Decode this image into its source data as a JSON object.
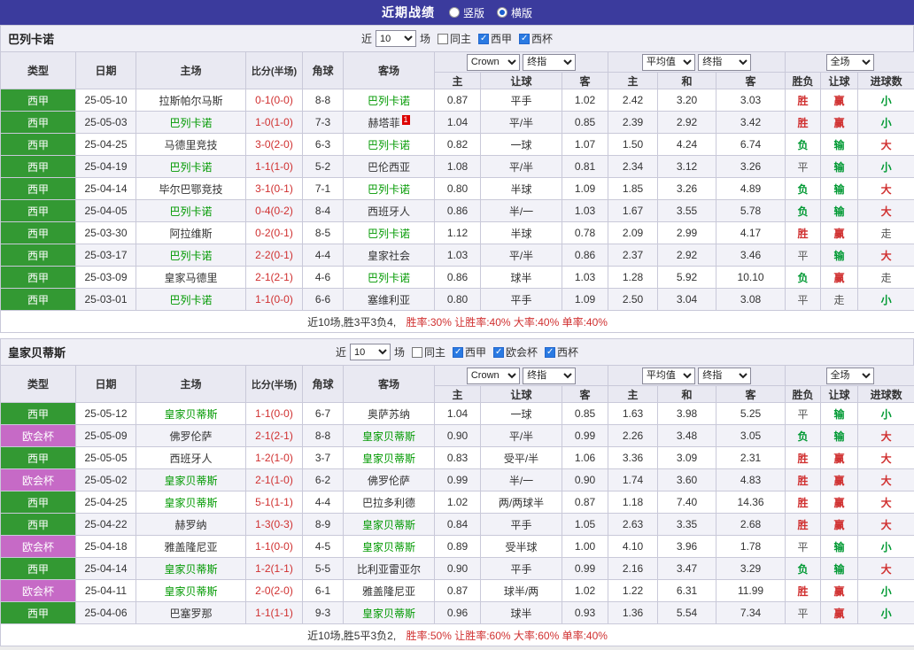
{
  "colors": {
    "topbar_bg": "#3b3b9d",
    "header_bg": "#e9e9f2",
    "liga_green": "#339933",
    "uecl_purple": "#c66ac6",
    "focus_team_green": "#009900",
    "win_red": "#d03030",
    "lose_green": "#009933",
    "draw_gray": "#555555"
  },
  "top_bar": {
    "title": "近期战绩",
    "radios": [
      {
        "label": "竖版",
        "selected": false
      },
      {
        "label": "横版",
        "selected": true
      }
    ]
  },
  "sections": [
    {
      "team": "巴列卡诺",
      "filter": {
        "prefix": "近",
        "count": "10",
        "suffix": "场",
        "checkboxes": [
          {
            "label": "同主",
            "checked": false
          },
          {
            "label": "西甲",
            "checked": true
          },
          {
            "label": "西杯",
            "checked": true
          }
        ]
      },
      "header": {
        "type": "类型",
        "date": "日期",
        "home": "主场",
        "score": "比分(半场)",
        "corner": "角球",
        "away": "客场",
        "odds_select1": "Crown",
        "odds_select2": "终指",
        "odds_home": "主",
        "odds_line": "让球",
        "odds_away": "客",
        "avg_select1": "平均值",
        "avg_select2": "终指",
        "avg_home": "主",
        "avg_draw": "和",
        "avg_away": "客",
        "result_select": "全场",
        "result_wdl": "胜负",
        "result_handicap": "让球",
        "result_goals": "进球数"
      },
      "rows": [
        {
          "league": "西甲",
          "lcls": "liga",
          "date": "25-05-10",
          "home": "拉斯帕尔马斯",
          "hf": false,
          "score": "0-1(0-0)",
          "corner": "8-8",
          "away": "巴列卡诺",
          "af": true,
          "odds": [
            "0.87",
            "平手",
            "1.02"
          ],
          "avg": [
            "2.42",
            "3.20",
            "3.03"
          ],
          "res": [
            [
              "胜",
              "r"
            ],
            [
              "赢",
              "r"
            ],
            [
              "小",
              "g"
            ]
          ]
        },
        {
          "league": "西甲",
          "lcls": "liga",
          "date": "25-05-03",
          "home": "巴列卡诺",
          "hf": true,
          "score": "1-0(1-0)",
          "corner": "7-3",
          "away": "赫塔菲",
          "af": false,
          "acard": "1",
          "odds": [
            "1.04",
            "平/半",
            "0.85"
          ],
          "avg": [
            "2.39",
            "2.92",
            "3.42"
          ],
          "res": [
            [
              "胜",
              "r"
            ],
            [
              "赢",
              "r"
            ],
            [
              "小",
              "g"
            ]
          ]
        },
        {
          "league": "西甲",
          "lcls": "liga",
          "date": "25-04-25",
          "home": "马德里竞技",
          "hf": false,
          "score": "3-0(2-0)",
          "corner": "6-3",
          "away": "巴列卡诺",
          "af": true,
          "odds": [
            "0.82",
            "一球",
            "1.07"
          ],
          "avg": [
            "1.50",
            "4.24",
            "6.74"
          ],
          "res": [
            [
              "负",
              "g"
            ],
            [
              "输",
              "g"
            ],
            [
              "大",
              "r"
            ]
          ]
        },
        {
          "league": "西甲",
          "lcls": "liga",
          "date": "25-04-19",
          "home": "巴列卡诺",
          "hf": true,
          "score": "1-1(1-0)",
          "corner": "5-2",
          "away": "巴伦西亚",
          "af": false,
          "odds": [
            "1.08",
            "平/半",
            "0.81"
          ],
          "avg": [
            "2.34",
            "3.12",
            "3.26"
          ],
          "res": [
            [
              "平",
              "d"
            ],
            [
              "输",
              "g"
            ],
            [
              "小",
              "g"
            ]
          ]
        },
        {
          "league": "西甲",
          "lcls": "liga",
          "date": "25-04-14",
          "home": "毕尔巴鄂竞技",
          "hf": false,
          "score": "3-1(0-1)",
          "corner": "7-1",
          "away": "巴列卡诺",
          "af": true,
          "odds": [
            "0.80",
            "半球",
            "1.09"
          ],
          "avg": [
            "1.85",
            "3.26",
            "4.89"
          ],
          "res": [
            [
              "负",
              "g"
            ],
            [
              "输",
              "g"
            ],
            [
              "大",
              "r"
            ]
          ]
        },
        {
          "league": "西甲",
          "lcls": "liga",
          "date": "25-04-05",
          "home": "巴列卡诺",
          "hf": true,
          "score": "0-4(0-2)",
          "corner": "8-4",
          "away": "西班牙人",
          "af": false,
          "odds": [
            "0.86",
            "半/一",
            "1.03"
          ],
          "avg": [
            "1.67",
            "3.55",
            "5.78"
          ],
          "res": [
            [
              "负",
              "g"
            ],
            [
              "输",
              "g"
            ],
            [
              "大",
              "r"
            ]
          ]
        },
        {
          "league": "西甲",
          "lcls": "liga",
          "date": "25-03-30",
          "home": "阿拉维斯",
          "hf": false,
          "score": "0-2(0-1)",
          "corner": "8-5",
          "away": "巴列卡诺",
          "af": true,
          "odds": [
            "1.12",
            "半球",
            "0.78"
          ],
          "avg": [
            "2.09",
            "2.99",
            "4.17"
          ],
          "res": [
            [
              "胜",
              "r"
            ],
            [
              "赢",
              "r"
            ],
            [
              "走",
              "d"
            ]
          ]
        },
        {
          "league": "西甲",
          "lcls": "liga",
          "date": "25-03-17",
          "home": "巴列卡诺",
          "hf": true,
          "score": "2-2(0-1)",
          "corner": "4-4",
          "away": "皇家社会",
          "af": false,
          "odds": [
            "1.03",
            "平/半",
            "0.86"
          ],
          "avg": [
            "2.37",
            "2.92",
            "3.46"
          ],
          "res": [
            [
              "平",
              "d"
            ],
            [
              "输",
              "g"
            ],
            [
              "大",
              "r"
            ]
          ]
        },
        {
          "league": "西甲",
          "lcls": "liga",
          "date": "25-03-09",
          "home": "皇家马德里",
          "hf": false,
          "score": "2-1(2-1)",
          "corner": "4-6",
          "away": "巴列卡诺",
          "af": true,
          "odds": [
            "0.86",
            "球半",
            "1.03"
          ],
          "avg": [
            "1.28",
            "5.92",
            "10.10"
          ],
          "res": [
            [
              "负",
              "g"
            ],
            [
              "赢",
              "r"
            ],
            [
              "走",
              "d"
            ]
          ]
        },
        {
          "league": "西甲",
          "lcls": "liga",
          "date": "25-03-01",
          "home": "巴列卡诺",
          "hf": true,
          "score": "1-1(0-0)",
          "corner": "6-6",
          "away": "塞维利亚",
          "af": false,
          "odds": [
            "0.80",
            "平手",
            "1.09"
          ],
          "avg": [
            "2.50",
            "3.04",
            "3.08"
          ],
          "res": [
            [
              "平",
              "d"
            ],
            [
              "走",
              "d"
            ],
            [
              "小",
              "g"
            ]
          ]
        }
      ],
      "footer": {
        "summary": "近10场,胜3平3负4,",
        "rates": "胜率:30% 让胜率:40% 大率:40% 单率:40%"
      }
    },
    {
      "team": "皇家贝蒂斯",
      "filter": {
        "prefix": "近",
        "count": "10",
        "suffix": "场",
        "checkboxes": [
          {
            "label": "同主",
            "checked": false
          },
          {
            "label": "西甲",
            "checked": true
          },
          {
            "label": "欧会杯",
            "checked": true
          },
          {
            "label": "西杯",
            "checked": true
          }
        ]
      },
      "header": {
        "type": "类型",
        "date": "日期",
        "home": "主场",
        "score": "比分(半场)",
        "corner": "角球",
        "away": "客场",
        "odds_select1": "Crown",
        "odds_select2": "终指",
        "odds_home": "主",
        "odds_line": "让球",
        "odds_away": "客",
        "avg_select1": "平均值",
        "avg_select2": "终指",
        "avg_home": "主",
        "avg_draw": "和",
        "avg_away": "客",
        "result_select": "全场",
        "result_wdl": "胜负",
        "result_handicap": "让球",
        "result_goals": "进球数"
      },
      "rows": [
        {
          "league": "西甲",
          "lcls": "liga",
          "date": "25-05-12",
          "home": "皇家贝蒂斯",
          "hf": true,
          "score": "1-1(0-0)",
          "corner": "6-7",
          "away": "奥萨苏纳",
          "af": false,
          "odds": [
            "1.04",
            "一球",
            "0.85"
          ],
          "avg": [
            "1.63",
            "3.98",
            "5.25"
          ],
          "res": [
            [
              "平",
              "d"
            ],
            [
              "输",
              "g"
            ],
            [
              "小",
              "g"
            ]
          ]
        },
        {
          "league": "欧会杯",
          "lcls": "uecl",
          "date": "25-05-09",
          "home": "佛罗伦萨",
          "hf": false,
          "score": "2-1(2-1)",
          "corner": "8-8",
          "away": "皇家贝蒂斯",
          "af": true,
          "odds": [
            "0.90",
            "平/半",
            "0.99"
          ],
          "avg": [
            "2.26",
            "3.48",
            "3.05"
          ],
          "res": [
            [
              "负",
              "g"
            ],
            [
              "输",
              "g"
            ],
            [
              "大",
              "r"
            ]
          ]
        },
        {
          "league": "西甲",
          "lcls": "liga",
          "date": "25-05-05",
          "home": "西班牙人",
          "hf": false,
          "score": "1-2(1-0)",
          "corner": "3-7",
          "away": "皇家贝蒂斯",
          "af": true,
          "odds": [
            "0.83",
            "受平/半",
            "1.06"
          ],
          "avg": [
            "3.36",
            "3.09",
            "2.31"
          ],
          "res": [
            [
              "胜",
              "r"
            ],
            [
              "赢",
              "r"
            ],
            [
              "大",
              "r"
            ]
          ]
        },
        {
          "league": "欧会杯",
          "lcls": "uecl",
          "date": "25-05-02",
          "home": "皇家贝蒂斯",
          "hf": true,
          "score": "2-1(1-0)",
          "corner": "6-2",
          "away": "佛罗伦萨",
          "af": false,
          "odds": [
            "0.99",
            "半/一",
            "0.90"
          ],
          "avg": [
            "1.74",
            "3.60",
            "4.83"
          ],
          "res": [
            [
              "胜",
              "r"
            ],
            [
              "赢",
              "r"
            ],
            [
              "大",
              "r"
            ]
          ]
        },
        {
          "league": "西甲",
          "lcls": "liga",
          "date": "25-04-25",
          "home": "皇家贝蒂斯",
          "hf": true,
          "score": "5-1(1-1)",
          "corner": "4-4",
          "away": "巴拉多利德",
          "af": false,
          "odds": [
            "1.02",
            "两/两球半",
            "0.87"
          ],
          "avg": [
            "1.18",
            "7.40",
            "14.36"
          ],
          "res": [
            [
              "胜",
              "r"
            ],
            [
              "赢",
              "r"
            ],
            [
              "大",
              "r"
            ]
          ]
        },
        {
          "league": "西甲",
          "lcls": "liga",
          "date": "25-04-22",
          "home": "赫罗纳",
          "hf": false,
          "score": "1-3(0-3)",
          "corner": "8-9",
          "away": "皇家贝蒂斯",
          "af": true,
          "odds": [
            "0.84",
            "平手",
            "1.05"
          ],
          "avg": [
            "2.63",
            "3.35",
            "2.68"
          ],
          "res": [
            [
              "胜",
              "r"
            ],
            [
              "赢",
              "r"
            ],
            [
              "大",
              "r"
            ]
          ]
        },
        {
          "league": "欧会杯",
          "lcls": "uecl",
          "date": "25-04-18",
          "home": "雅盖隆尼亚",
          "hf": false,
          "score": "1-1(0-0)",
          "corner": "4-5",
          "away": "皇家贝蒂斯",
          "af": true,
          "odds": [
            "0.89",
            "受半球",
            "1.00"
          ],
          "avg": [
            "4.10",
            "3.96",
            "1.78"
          ],
          "res": [
            [
              "平",
              "d"
            ],
            [
              "输",
              "g"
            ],
            [
              "小",
              "g"
            ]
          ]
        },
        {
          "league": "西甲",
          "lcls": "liga",
          "date": "25-04-14",
          "home": "皇家贝蒂斯",
          "hf": true,
          "score": "1-2(1-1)",
          "corner": "5-5",
          "away": "比利亚雷亚尔",
          "af": false,
          "odds": [
            "0.90",
            "平手",
            "0.99"
          ],
          "avg": [
            "2.16",
            "3.47",
            "3.29"
          ],
          "res": [
            [
              "负",
              "g"
            ],
            [
              "输",
              "g"
            ],
            [
              "大",
              "r"
            ]
          ]
        },
        {
          "league": "欧会杯",
          "lcls": "uecl",
          "date": "25-04-11",
          "home": "皇家贝蒂斯",
          "hf": true,
          "score": "2-0(2-0)",
          "corner": "6-1",
          "away": "雅盖隆尼亚",
          "af": false,
          "odds": [
            "0.87",
            "球半/两",
            "1.02"
          ],
          "avg": [
            "1.22",
            "6.31",
            "11.99"
          ],
          "res": [
            [
              "胜",
              "r"
            ],
            [
              "赢",
              "r"
            ],
            [
              "小",
              "g"
            ]
          ]
        },
        {
          "league": "西甲",
          "lcls": "liga",
          "date": "25-04-06",
          "home": "巴塞罗那",
          "hf": false,
          "score": "1-1(1-1)",
          "corner": "9-3",
          "away": "皇家贝蒂斯",
          "af": true,
          "odds": [
            "0.96",
            "球半",
            "0.93"
          ],
          "avg": [
            "1.36",
            "5.54",
            "7.34"
          ],
          "res": [
            [
              "平",
              "d"
            ],
            [
              "赢",
              "r"
            ],
            [
              "小",
              "g"
            ]
          ]
        }
      ],
      "footer": {
        "summary": "近10场,胜5平3负2,",
        "rates": "胜率:50% 让胜率:60% 大率:60% 单率:40%"
      }
    }
  ]
}
